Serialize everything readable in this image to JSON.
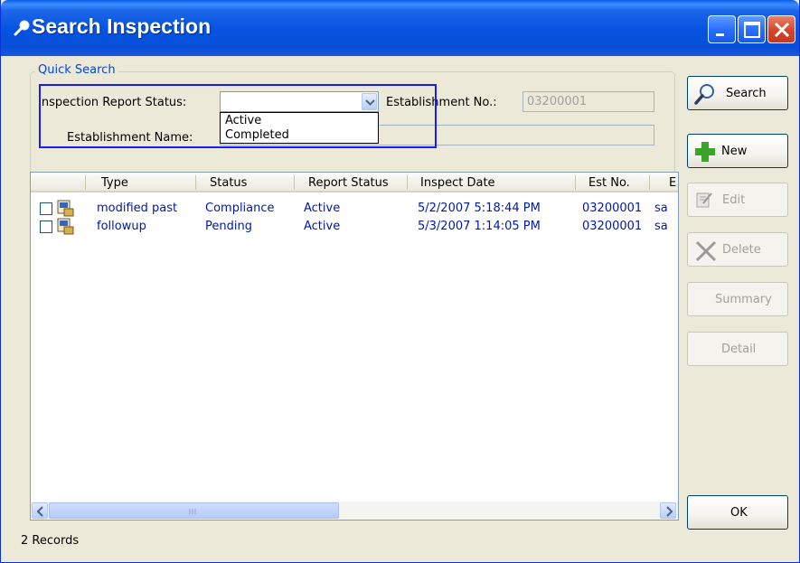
{
  "window": {
    "title": "Search Inspection"
  },
  "quick_search": {
    "legend": "Quick Search",
    "report_status_label": "Inspection Report Status:",
    "report_status_value": "",
    "report_status_options": [
      "Active",
      "Completed"
    ],
    "establishment_no_label": "Establishment No.:",
    "establishment_no_value": "03200001",
    "establishment_name_label": "Establishment Name:",
    "establishment_name_value": ""
  },
  "buttons": {
    "search": "Search",
    "new": "New",
    "edit": "Edit",
    "delete": "Delete",
    "summary": "Summary",
    "detail": "Detail",
    "ok": "OK"
  },
  "list": {
    "columns": [
      "Type",
      "Status",
      "Report Status",
      "Inspect Date",
      "Est No.",
      "E"
    ],
    "rows": [
      {
        "type": "modified past",
        "status": "Compliance",
        "report_status": "Active",
        "inspect_date": "5/2/2007 5:18:44 PM",
        "est_no": "03200001",
        "extra": "sa"
      },
      {
        "type": "followup",
        "status": "Pending",
        "report_status": "Active",
        "inspect_date": "5/3/2007 1:14:05 PM",
        "est_no": "03200001",
        "extra": "sa"
      }
    ]
  },
  "status_bar": {
    "records": "2 Records"
  },
  "colors": {
    "title_bar": "#0553e0",
    "link_text": "#0018a8",
    "highlight": "#1a1aff"
  }
}
